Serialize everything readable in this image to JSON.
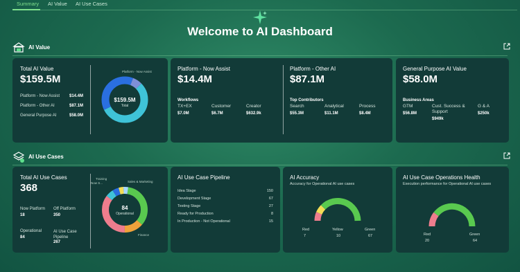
{
  "tabs": [
    {
      "label": "Summary",
      "active": true
    },
    {
      "label": "AI Value",
      "active": false
    },
    {
      "label": "AI Use Cases",
      "active": false
    }
  ],
  "welcome": "Welcome to AI Dashboard",
  "colors": {
    "accent": "#7fe08d",
    "card_bg": "#123b38",
    "blue": "#2a6fe0",
    "cyan": "#3fc3d8",
    "green": "#59c94f",
    "pink": "#ee7d8d",
    "yellow": "#f3dc56",
    "orange": "#f0a23b"
  },
  "ai_value": {
    "section_title": "AI Value",
    "total": {
      "title": "Total AI Value",
      "value": "$159.5M",
      "rows": [
        {
          "label": "Platform - Now Assist",
          "value": "$14.4M"
        },
        {
          "label": "Platform - Other AI",
          "value": "$87.1M"
        },
        {
          "label": "General Purpose AI",
          "value": "$58.0M"
        }
      ],
      "donut_center": "$159.5M",
      "donut_sub": "Total",
      "donut_callout": "Platform - Now Assist"
    },
    "now_assist": {
      "title": "Platform - Now Assist",
      "value": "$14.4M",
      "group_label": "Workflows",
      "items": [
        {
          "label": "TX+EX",
          "value": "$7.0M"
        },
        {
          "label": "Customer",
          "value": "$6.7M"
        },
        {
          "label": "Creator",
          "value": "$632.9k"
        }
      ]
    },
    "other_ai": {
      "title": "Platform - Other AI",
      "value": "$87.1M",
      "group_label": "Top Contributors",
      "items": [
        {
          "label": "Search",
          "value": "$55.3M"
        },
        {
          "label": "Analytical",
          "value": "$11.1M"
        },
        {
          "label": "Process",
          "value": "$8.4M"
        }
      ]
    },
    "general": {
      "title": "General Purpose AI Value",
      "value": "$58.0M",
      "group_label": "Business Areas",
      "items": [
        {
          "label": "GTM",
          "value": "$56.8M"
        },
        {
          "label": "Cust. Success & Support",
          "value": "$949k"
        },
        {
          "label": "G & A",
          "value": "$250k"
        }
      ]
    }
  },
  "use_cases": {
    "section_title": "AI Use Cases",
    "total": {
      "title": "Total AI Use Cases",
      "value": "368",
      "rows": [
        {
          "label": "Now Platform",
          "value": "18"
        },
        {
          "label": "Off Platform",
          "value": "350"
        },
        {
          "label": "Operational",
          "value": "84"
        },
        {
          "label": "AI Use Case Pipeline",
          "value": "267"
        }
      ],
      "donut_center": "84",
      "donut_sub": "Operational",
      "labels": [
        "Training",
        "Now S...",
        "Sales & Marketing",
        "Finance"
      ]
    },
    "pipeline": {
      "title": "AI Use Case Pipeline",
      "rows": [
        {
          "label": "Idea Stage",
          "value": "150"
        },
        {
          "label": "Development Stage",
          "value": "67"
        },
        {
          "label": "Testing Stage",
          "value": "27"
        },
        {
          "label": "Ready for Production",
          "value": "8"
        },
        {
          "label": "In Production - Not Operational",
          "value": "15"
        }
      ]
    },
    "accuracy": {
      "title": "AI Accuracy",
      "subtitle": "Accuracy for Operational AI use cases",
      "legend": [
        {
          "label": "Red",
          "value": "7"
        },
        {
          "label": "Yellow",
          "value": "10"
        },
        {
          "label": "Green",
          "value": "67"
        }
      ]
    },
    "health": {
      "title": "AI Use Case Operations Health",
      "subtitle": "Execution performance for Operational AI use cases",
      "legend": [
        {
          "label": "Red",
          "value": "20"
        },
        {
          "label": "Green",
          "value": "64"
        }
      ]
    }
  }
}
